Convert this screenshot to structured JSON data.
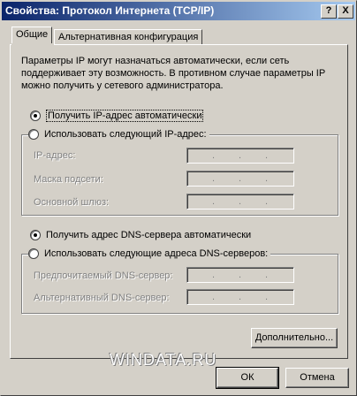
{
  "window": {
    "title": "Свойства: Протокол Интернета (TCP/IP)",
    "help_label": "?",
    "close_label": "X"
  },
  "tabs": [
    {
      "label": "Общие",
      "active": true
    },
    {
      "label": "Альтернативная конфигурация",
      "active": false
    }
  ],
  "description": "Параметры IP могут назначаться автоматически, если сеть поддерживает эту возможность. В противном случае параметры IP можно получить у сетевого администратора.",
  "ip": {
    "auto_label": "Получить IP-адрес автоматически",
    "auto_selected": true,
    "manual_label": "Использовать следующий IP-адрес:",
    "fields": [
      {
        "label": "IP-адрес:"
      },
      {
        "label": "Маска подсети:"
      },
      {
        "label": "Основной шлюз:"
      }
    ]
  },
  "dns": {
    "auto_label": "Получить адрес DNS-сервера автоматически",
    "auto_selected": true,
    "manual_label": "Использовать следующие адреса DNS-серверов:",
    "fields": [
      {
        "label": "Предпочитаемый DNS-сервер:"
      },
      {
        "label": "Альтернативный DNS-сервер:"
      }
    ]
  },
  "ip_dot": ".",
  "buttons": {
    "advanced": "Дополнительно...",
    "ok": "ОК",
    "cancel": "Отмена"
  },
  "watermark": "WINDATA.RU",
  "colors": {
    "titlebar_start": "#0a246a",
    "titlebar_end": "#a6caf0",
    "face": "#d4d0c8",
    "disabled_text": "#808080"
  }
}
